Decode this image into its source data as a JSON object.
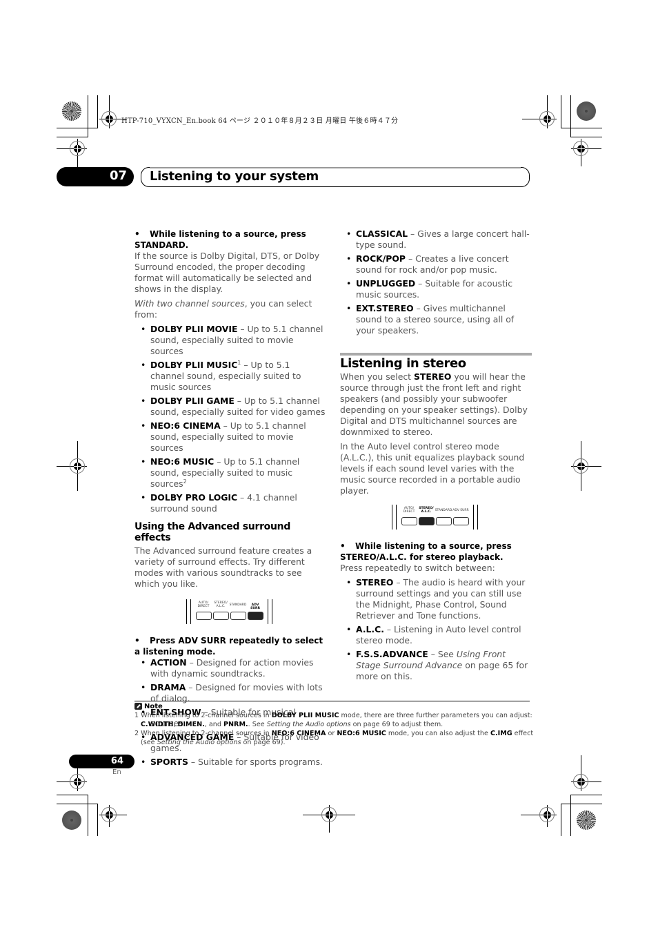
{
  "print_info": {
    "jobline": "HTP-710_VYXCN_En.book   64 ページ   ２０１０年８月２３日   月曜日   午後６時４７分"
  },
  "header": {
    "chapter_number": "07",
    "chapter_title": "Listening to your system"
  },
  "left_column": {
    "step1": {
      "bullet": "•",
      "text": "While listening to a source, press STANDARD."
    },
    "step1_body": "If the source is Dolby Digital, DTS, or Dolby Surround encoded, the proper decoding format will automatically be selected and shows in the display.",
    "two_channel_intro_italic": "With two channel sources",
    "two_channel_intro_rest": ", you can select from:",
    "modes": [
      {
        "name": "DOLBY PLII MOVIE",
        "sup": "",
        "desc": " – Up to 5.1 channel sound, especially suited to movie sources",
        "desc_sup": ""
      },
      {
        "name": "DOLBY PLII MUSIC",
        "sup": "1",
        "desc": " – Up to 5.1 channel sound, especially suited to music sources",
        "desc_sup": ""
      },
      {
        "name": "DOLBY PLII GAME",
        "sup": "",
        "desc": " – Up to 5.1 channel sound, especially suited for video games",
        "desc_sup": ""
      },
      {
        "name": "NEO:6 CINEMA",
        "sup": "",
        "desc": " – Up to 5.1 channel sound, especially suited to movie sources",
        "desc_sup": ""
      },
      {
        "name": "NEO:6 MUSIC",
        "sup": "",
        "desc": " – Up to 5.1 channel sound, especially suited to music sources",
        "desc_sup": "2"
      },
      {
        "name": "DOLBY PRO LOGIC",
        "sup": "",
        "desc": " – 4.1 channel surround sound",
        "desc_sup": ""
      }
    ],
    "adv_heading": "Using the Advanced surround effects",
    "adv_body": "The Advanced surround feature creates a variety of surround effects. Try different modes with various soundtracks to see which you like.",
    "step2": {
      "bullet": "•",
      "text": "Press ADV SURR repeatedly to select a listening mode."
    },
    "adv_modes": [
      {
        "name": "ACTION",
        "desc": " – Designed for action movies with dynamic soundtracks."
      },
      {
        "name": "DRAMA",
        "desc": " – Designed for movies with lots of dialog."
      },
      {
        "name": "ENT.SHOW",
        "desc": " – Suitable for musical sources."
      },
      {
        "name": "ADVANCED GAME",
        "desc": " – Suitable for video games."
      },
      {
        "name": "SPORTS",
        "desc": " – Suitable for sports programs."
      }
    ]
  },
  "remote_buttons": {
    "labels": [
      "AUTO/ DIRECT",
      "STEREO/ A.L.C.",
      "STANDARD",
      "ADV SURR"
    ],
    "adv_highlight": "ADV SURR",
    "stereo_highlight": "STEREO/ A.L.C."
  },
  "right_column": {
    "adv_modes_cont": [
      {
        "name": "CLASSICAL",
        "desc": " – Gives a large concert hall-type sound."
      },
      {
        "name": "ROCK/POP",
        "desc": " – Creates a live concert sound for rock and/or pop music."
      },
      {
        "name": "UNPLUGGED",
        "desc": " – Suitable for acoustic music sources."
      },
      {
        "name": "EXT.STEREO",
        "desc": " – Gives multichannel sound to a stereo source, using all of your speakers."
      }
    ],
    "stereo_heading": "Listening in stereo",
    "stereo_body_pre": "When you select ",
    "stereo_body_key": "STEREO",
    "stereo_body_post": " you will hear the source through just the front left and right speakers (and possibly your subwoofer depending on your speaker settings). Dolby Digital and DTS multichannel sources are downmixed to stereo.",
    "alc_body": "In the Auto level control stereo mode (A.L.C.), this unit equalizes playback sound levels if each sound level varies with the music source recorded in a portable audio player.",
    "step3": {
      "bullet": "•",
      "text": "While listening to a source, press STEREO/A.L.C. for stereo playback."
    },
    "step3_body": "Press repeatedly to switch between:",
    "stereo_modes": [
      {
        "name": "STEREO",
        "desc": " – The audio is heard with your surround settings and you can still use the Midnight, Phase Control, Sound Retriever and Tone functions."
      },
      {
        "name": "A.L.C.",
        "desc": " – Listening in Auto level control stereo mode."
      }
    ],
    "fss": {
      "name": "F.S.S.ADVANCE",
      "pre": " – See ",
      "ref": "Using Front Stage Surround Advance",
      "post": " on page 65 for more on this."
    }
  },
  "notes": {
    "title": "Note",
    "n1": {
      "num": "1",
      "a": " When listening to 2-channel sources in ",
      "k1": "DOLBY PLII MUSIC",
      "b": " mode, there are three further parameters you can adjust: ",
      "k2": "C.WIDTH",
      "c": ", ",
      "k3": "DIMEN.",
      "d": ", and ",
      "k4": "PNRM.",
      "e": ". See ",
      "ref": "Setting the Audio options",
      "f": " on page 69 to adjust them."
    },
    "n2": {
      "num": "2",
      "a": " When listening to 2-channel sources in ",
      "k1": "NEO:6 CINEMA",
      "b": " or ",
      "k2": "NEO:6 MUSIC",
      "c": " mode, you can also adjust the ",
      "k3": "C.IMG",
      "d": " effect (see ",
      "ref": "Setting the Audio options",
      "e": " on page 69)."
    }
  },
  "footer": {
    "page_number": "64",
    "language": "En"
  }
}
